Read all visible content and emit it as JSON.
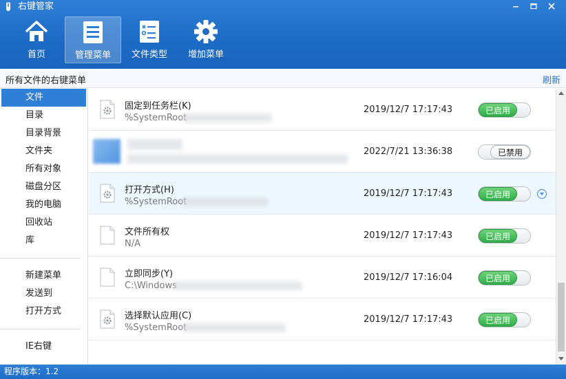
{
  "app": {
    "title": "右键管家"
  },
  "window_controls": {
    "minimize": "—",
    "restore": "▭",
    "close": "✕"
  },
  "nav": [
    {
      "label": "首页",
      "icon": "home-icon"
    },
    {
      "label": "管理菜单",
      "icon": "menu-list-icon"
    },
    {
      "label": "文件类型",
      "icon": "file-checklist-icon"
    },
    {
      "label": "增加菜单",
      "icon": "gear-icon"
    }
  ],
  "header": {
    "title": "所有文件的右键菜单",
    "refresh": "刷新"
  },
  "sidebar": {
    "group1": [
      "文件",
      "目录",
      "目录背景",
      "文件夹",
      "所有对象",
      "磁盘分区",
      "我的电脑",
      "回收站",
      "库"
    ],
    "group2": [
      "新建菜单",
      "发送到",
      "打开方式"
    ],
    "group3": [
      "IE右键"
    ]
  },
  "rows": [
    {
      "name": "固定到任务栏(K)",
      "path": "%SystemRoot",
      "date": "2019/12/7 17:17:43",
      "status": "已启用"
    },
    {
      "name": "",
      "path": "",
      "date": "2022/7/21 13:36:38",
      "status": "已禁用"
    },
    {
      "name": "打开方式(H)",
      "path": "%SystemRoot",
      "date": "2019/12/7 17:17:43",
      "status": "已启用"
    },
    {
      "name": "文件所有权",
      "path": "N/A",
      "date": "2019/12/7 17:17:43",
      "status": "已启用"
    },
    {
      "name": "立即同步(Y)",
      "path": "C:\\Windows",
      "date": "2019/12/7 17:16:04",
      "status": "已启用"
    },
    {
      "name": "选择默认应用(C)",
      "path": "%SystemRoot",
      "date": "2019/12/7 17:17:43",
      "status": "已启用"
    }
  ],
  "status_bar": {
    "version": "程序版本：1.2"
  },
  "colors": {
    "accent": "#1d6cc7",
    "enabled": "#2fae48",
    "link": "#2a72c8"
  }
}
